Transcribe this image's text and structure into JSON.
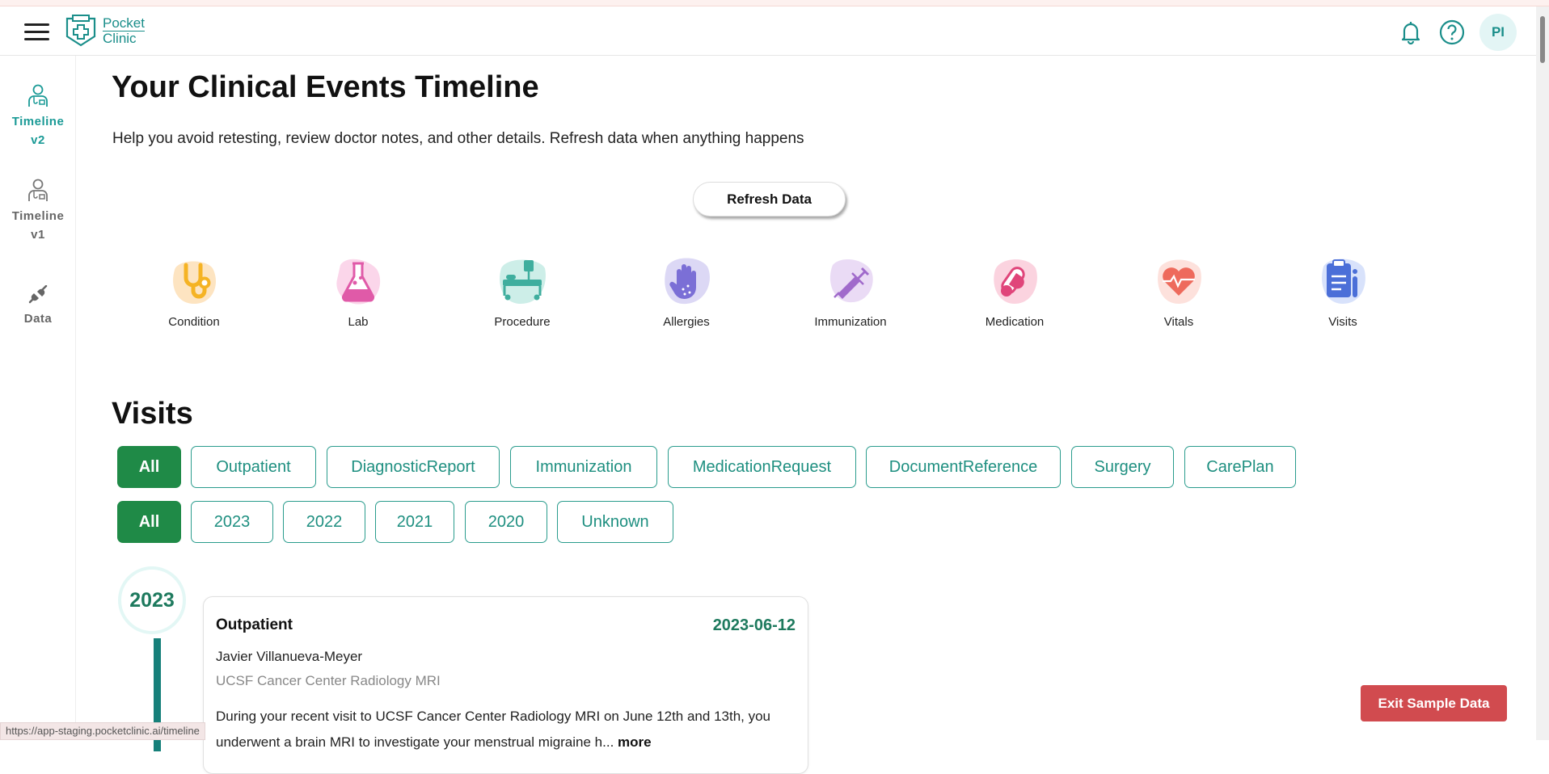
{
  "header": {
    "logo_line1": "Pocket",
    "logo_line2": "Clinic",
    "avatar_initials": "PI"
  },
  "sidebar": {
    "items": [
      {
        "label_line1": "Timeline",
        "label_line2": "v2",
        "icon": "doctor-icon",
        "active": true
      },
      {
        "label_line1": "Timeline",
        "label_line2": "v1",
        "icon": "doctor-icon",
        "active": false
      },
      {
        "label_line1": "Data",
        "label_line2": "",
        "icon": "plug-icon",
        "active": false
      }
    ]
  },
  "main": {
    "title": "Your Clinical Events Timeline",
    "subtitle": "Help you avoid retesting, review doctor notes, and other details. Refresh data when anything happens",
    "refresh_label": "Refresh Data",
    "categories": [
      {
        "label": "Condition",
        "icon": "stethoscope-icon",
        "color": "#f5b324"
      },
      {
        "label": "Lab",
        "icon": "flask-icon",
        "color": "#e05aa8"
      },
      {
        "label": "Procedure",
        "icon": "hospital-bed-icon",
        "color": "#3fae9e"
      },
      {
        "label": "Allergies",
        "icon": "hand-icon",
        "color": "#7b6fd6"
      },
      {
        "label": "Immunization",
        "icon": "syringe-icon",
        "color": "#a06acb"
      },
      {
        "label": "Medication",
        "icon": "pills-icon",
        "color": "#e0457a"
      },
      {
        "label": "Vitals",
        "icon": "heart-pulse-icon",
        "color": "#ee6a5c"
      },
      {
        "label": "Visits",
        "icon": "clipboard-icon",
        "color": "#4b6fd8"
      }
    ],
    "section_title": "Visits",
    "type_filters": [
      "All",
      "Outpatient",
      "DiagnosticReport",
      "Immunization",
      "MedicationRequest",
      "DocumentReference",
      "Surgery",
      "CarePlan"
    ],
    "year_filters": [
      "All",
      "2023",
      "2022",
      "2021",
      "2020",
      "Unknown"
    ],
    "timeline": {
      "year": "2023",
      "card": {
        "type": "Outpatient",
        "date": "2023-06-12",
        "doctor": "Javier Villanueva-Meyer",
        "location": "UCSF Cancer Center Radiology MRI",
        "description": "During your recent visit to UCSF Cancer Center Radiology MRI on June 12th and 13th, you underwent a brain MRI to investigate your menstrual migraine h...",
        "more_label": "more"
      }
    }
  },
  "exit_label": "Exit Sample Data",
  "status_url": "https://app-staging.pocketclinic.ai/timeline",
  "colors": {
    "brand": "#1a8e8a",
    "active_filter": "#1f8a47",
    "filter_border": "#2a9c8d",
    "exit_button": "#d14b4f"
  }
}
